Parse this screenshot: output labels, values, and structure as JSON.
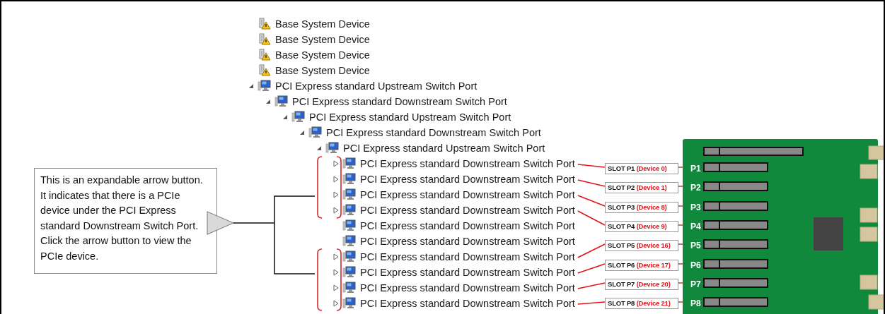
{
  "tree": {
    "items": [
      {
        "label": "Base System Device",
        "kind": "warning"
      },
      {
        "label": "Base System Device",
        "kind": "warning"
      },
      {
        "label": "Base System Device",
        "kind": "warning"
      },
      {
        "label": "Base System Device",
        "kind": "warning"
      },
      {
        "label": "PCI Express standard Upstream Switch Port",
        "kind": "port",
        "expanded": true,
        "children": [
          {
            "label": "PCI Express standard Downstream Switch Port",
            "kind": "port",
            "expanded": true,
            "children": [
              {
                "label": "PCI Express standard Upstream Switch Port",
                "kind": "port",
                "expanded": true,
                "children": [
                  {
                    "label": "PCI Express standard Downstream Switch Port",
                    "kind": "port",
                    "expanded": true,
                    "children": [
                      {
                        "label": "PCI Express standard Upstream Switch Port",
                        "kind": "port",
                        "expanded": true,
                        "children": [
                          {
                            "label": "PCI Express standard Downstream Switch Port",
                            "kind": "port",
                            "expanded": false
                          },
                          {
                            "label": "PCI Express standard Downstream Switch Port",
                            "kind": "port",
                            "expanded": false
                          },
                          {
                            "label": "PCI Express standard Downstream Switch Port",
                            "kind": "port",
                            "expanded": false
                          },
                          {
                            "label": "PCI Express standard Downstream Switch Port",
                            "kind": "port",
                            "expanded": false
                          },
                          {
                            "label": "PCI Express standard Downstream Switch Port",
                            "kind": "port"
                          },
                          {
                            "label": "PCI Express standard Downstream Switch Port",
                            "kind": "port"
                          },
                          {
                            "label": "PCI Express standard Downstream Switch Port",
                            "kind": "port",
                            "expanded": false
                          },
                          {
                            "label": "PCI Express standard Downstream Switch Port",
                            "kind": "port",
                            "expanded": false
                          },
                          {
                            "label": "PCI Express standard Downstream Switch Port",
                            "kind": "port",
                            "expanded": false
                          },
                          {
                            "label": "PCI Express standard Downstream Switch Port",
                            "kind": "port",
                            "expanded": false
                          }
                        ]
                      }
                    ]
                  }
                ]
              }
            ]
          }
        ]
      }
    ]
  },
  "callout": {
    "text": "This is an expandable arrow button. It indicates that there is a PCIe device under the  PCI Express standard Downstream Switch Port.  Click the arrow button to view the PCIe device."
  },
  "slots": [
    {
      "slot": "SLOT P1",
      "device": "(Device 0)",
      "port": "P1"
    },
    {
      "slot": "SLOT P2",
      "device": "(Device 1)",
      "port": "P2"
    },
    {
      "slot": "SLOT P3",
      "device": "(Device 8)",
      "port": "P3"
    },
    {
      "slot": "SLOT P4",
      "device": "(Device 9)",
      "port": "P4"
    },
    {
      "slot": "SLOT P5",
      "device": "(Device 16)",
      "port": "P5"
    },
    {
      "slot": "SLOT P6",
      "device": "(Device 17)",
      "port": "P6"
    },
    {
      "slot": "SLOT P7",
      "device": "(Device 20)",
      "port": "P7"
    },
    {
      "slot": "SLOT P8",
      "device": "(Device 21)",
      "port": "P8"
    }
  ]
}
